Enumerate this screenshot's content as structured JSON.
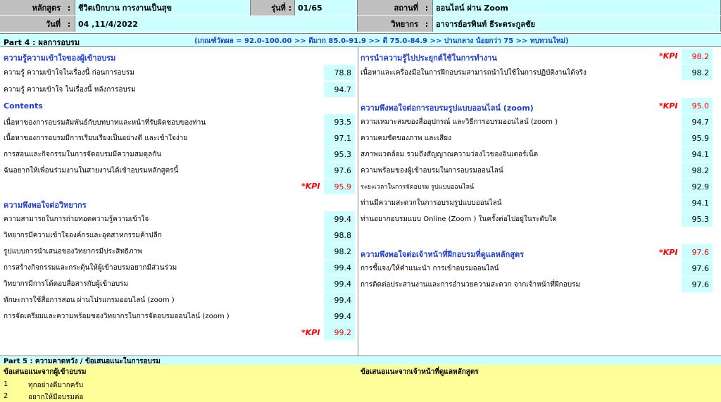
{
  "header": {
    "course_label": "หลักสูตร",
    "course_value": "ชีวิตเบิกบาน การงานเป็นสุข",
    "batch_label": "รุ่นที่ :",
    "batch_value": "01/65",
    "venue_label": "สถานที่",
    "venue_value": "ออนไลน์ ผ่าน Zoom",
    "date_label": "วันที่",
    "date_value": "04 ,11/4/2022",
    "speaker_label": "วิทยากร",
    "speaker_value": "อาจารย์อรพินท์ ธีระตระกูลชัย",
    "colon": ":"
  },
  "part4": {
    "title": "Part 4 : ผลการอบรม",
    "criteria": "(เกณฑ์วัดผล = 92.0-100.00 >> ดีมาก     85.0-91.9 >> ดี     75.0-84.9 >> ปานกลาง     น้อยกว่า 75 >> ทบทวนใหม่)"
  },
  "left": {
    "knowledge": {
      "title": "ความรู้ความเข้าใจของผู้เข้าอบรม",
      "items": [
        {
          "text": "ความรู้ ความเข้าใจในเรื่องนี้ ก่อนการอบรม",
          "score": "78.8"
        },
        {
          "text": "ความรู้ ความเข้าใจ ในเรื่องนี้   หลังการอบรม",
          "score": "94.7"
        }
      ]
    },
    "contents": {
      "title": "Contents",
      "items": [
        {
          "text": "เนื้อหาของการอบรมสัมพันธ์กับบทบาทและหน้าที่รับผิดชอบของท่าน",
          "score": "93.5"
        },
        {
          "text": "เนื้อหาของการอบรมมีการเรียบเรียงเป็นอย่างดี และเข้าใจง่าย",
          "score": "97.1"
        },
        {
          "text": "การสอนและกิจกรรมในการจัดอบรมมีความสมดุลกัน",
          "score": "95.3"
        },
        {
          "text": "ฉันอยากให้เพื่อนร่วมงานในสายงานได้เข้าอบรมหลักสูตรนี้",
          "score": "97.6"
        }
      ],
      "kpi_label": "*KPI",
      "kpi_value": "95.9"
    },
    "speaker": {
      "title": "ความพึงพอใจต่อวิทยากร",
      "items": [
        {
          "text": "ความสามารถในการถ่ายทอดความรู้ความเข้าใจ",
          "score": "99.4"
        },
        {
          "text": "วิทยากรมีความเข้าใจองค์กรและอุตสาหกรรมค้าปลีก",
          "score": "98.8"
        },
        {
          "text": "รูปแบบการนำเสนอของวิทยากรมีประสิทธิภาพ",
          "score": "98.2"
        },
        {
          "text": "การสร้างกิจกรรมและกระตุ้นให้ผู้เข้าอบรมอยากมีส่วนร่วม",
          "score": "99.4"
        },
        {
          "text": "วิทยากรมีการโต้ตอบสื่อสารกับผู้เข้าอบรม",
          "score": "99.4"
        },
        {
          "text": "ทักษะการใช้สื่อการสอน ผ่านโปรแกรมออนไลน์ (zoom )",
          "score": "99.4"
        },
        {
          "text": "การจัดเตรียมและความพร้อมของวิทยากรในการจัดอบรมออนไลน์ (zoom )",
          "score": "99.4"
        }
      ],
      "kpi_label": "*KPI",
      "kpi_value": "99.2"
    }
  },
  "right": {
    "apply": {
      "title": "การนำความรู้ไปประยุกต์ใช้ในการทำงาน",
      "kpi_label": "*KPI",
      "kpi_value": "98.2",
      "items": [
        {
          "text": "เนื้อหาและเครื่องมือในการฝึกอบรมสามารถนำไปใช้ในการปฏิบัติงานได้จริง",
          "score": "98.2"
        }
      ]
    },
    "online": {
      "title": "ความพึงพอใจต่อการอบรมรูปแบบออนไลน์ (zoom)",
      "kpi_label": "*KPI",
      "kpi_value": "95.0",
      "items": [
        {
          "text": "ความเหมาะสมของสื่ออุปกรณ์ และวิธีการอบรมออนไลน์ (zoom )",
          "score": "94.7"
        },
        {
          "text": "ความคมชัดของภาพ และเสียง",
          "score": "95.9"
        },
        {
          "text": "สภาพแวดล้อม รวมถึงสัญญาณความว่องไวของอินเตอร์เน็ต",
          "score": "94.1"
        },
        {
          "text": "ความพร้อมของผู้เข้าอบรมในการอบรมออนไลน์",
          "score": "98.2"
        },
        {
          "text": "ระยะเวลาในการจัดอบรม รูปแบบออนไลน์",
          "score": "92.9"
        },
        {
          "text": "ท่านมีความสะดวกในการอบรมรูปแบบออนไลน์",
          "score": "94.1"
        },
        {
          "text": "ท่านอยากอบรมแบบ Online (Zoom ) ในครั้งต่อไปอยู่ในระดับใด",
          "score": "95.3"
        }
      ]
    },
    "staff": {
      "title": "ความพึงพอใจต่อเจ้าหน้าที่ฝึกอบรมที่ดูแลหลักสูตร",
      "kpi_label": "*KPI",
      "kpi_value": "97.6",
      "items": [
        {
          "text": "การชี้แจง/ให้คำแนะนำ การเข้าอบรมออนไลน์",
          "score": "97.6"
        },
        {
          "text": "การติดต่อประสานงานและการอำนวยความสะดวก จากเจ้าหน้าที่ฝึกอบรม",
          "score": "97.6"
        }
      ]
    }
  },
  "part5": {
    "title": "Part 5 : ความคาดหวัง / ข้อเสนอแนะในการอบรม",
    "participant_title": "ข้อเสนอแนะจากผู้เข้าอบรม",
    "staff_title": "ข้อเสนอแนะจากเจ้าหน้าที่ดูแลหลักสูตร",
    "items": [
      {
        "no": "1",
        "text": "ทุกอย่างดีมากครับ"
      },
      {
        "no": "2",
        "text": "อยากให้มีอบรมต่อ"
      }
    ]
  }
}
